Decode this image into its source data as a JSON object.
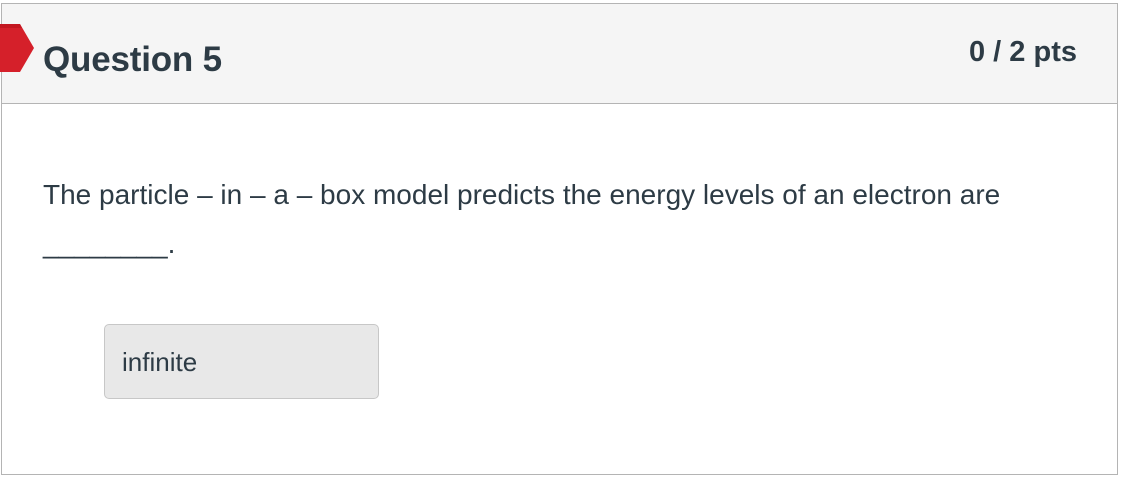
{
  "question": {
    "title": "Question 5",
    "points": "0 / 2 pts",
    "text": "The particle – in – a – box model predicts the energy levels of an electron are ________.",
    "status_icon": "incorrect-marker-icon",
    "answer": "infinite"
  },
  "colors": {
    "marker": "#d5202a",
    "header_bg": "#f5f5f5",
    "border": "#b4b4b4",
    "text": "#2d3b45",
    "answer_bg": "#e8e8e8"
  }
}
